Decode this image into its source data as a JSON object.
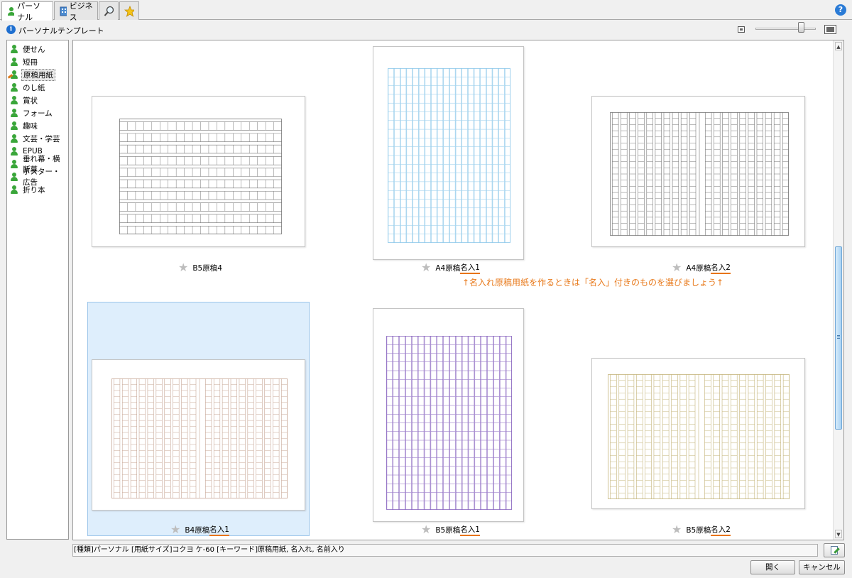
{
  "tabs": [
    {
      "label": "パーソナル",
      "icon": "person-icon"
    },
    {
      "label": "ビジネス",
      "icon": "building-icon"
    },
    {
      "label": "",
      "icon": "search-icon"
    },
    {
      "label": "",
      "icon": "favorites-star-icon"
    }
  ],
  "help": "?",
  "page_title": "パーソナルテンプレート",
  "zoom_level": 0.75,
  "sidebar": {
    "items": [
      {
        "label": "便せん"
      },
      {
        "label": "短冊"
      },
      {
        "label": "原稿用紙"
      },
      {
        "label": "のし紙"
      },
      {
        "label": "賞状"
      },
      {
        "label": "フォーム"
      },
      {
        "label": "趣味"
      },
      {
        "label": "文芸・学芸"
      },
      {
        "label": "EPUB"
      },
      {
        "label": "垂れ幕・横断幕"
      },
      {
        "label": "ポスター・広告"
      },
      {
        "label": "折り本"
      }
    ],
    "selected": "原稿用紙"
  },
  "templates": [
    {
      "prefix": "B5原稿4",
      "name": ""
    },
    {
      "prefix": "A4原稿",
      "name": "名入1"
    },
    {
      "prefix": "A4原稿",
      "name": "名入2"
    },
    {
      "prefix": "B4原稿",
      "name": "名入1"
    },
    {
      "prefix": "B5原稿",
      "name": "名入1"
    },
    {
      "prefix": "B5原稿",
      "name": "名入2"
    }
  ],
  "annotation": "↑名入れ原稿用紙を作るときは「名入」付きのものを選びましょう↑",
  "status_text": "[種類]パーソナル  [用紙サイズ]コクヨ ケ-60  [キーワード]原稿用紙, 名入れ, 名前入り",
  "buttons": {
    "open": "開く",
    "cancel": "キャンセル"
  },
  "colors": {
    "accent_underline": "#e87410",
    "annotation": "#e87a1c",
    "selection": "#deeefc"
  }
}
